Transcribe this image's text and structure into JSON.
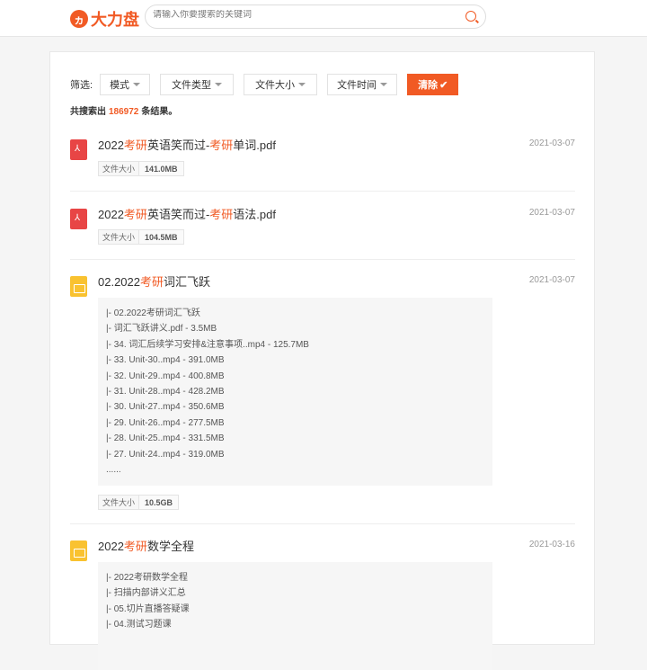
{
  "header": {
    "logo_text": "大力盘",
    "search_placeholder": "请输入你要搜索的关键词"
  },
  "filters": {
    "label": "筛选:",
    "buttons": [
      "模式",
      "文件类型",
      "文件大小",
      "文件时间"
    ],
    "clear_label": "清除"
  },
  "result_count": {
    "prefix": "共搜索出",
    "number": "186972",
    "suffix": "条结果。"
  },
  "size_label": "文件大小",
  "results": [
    {
      "type": "pdf",
      "title_parts": [
        "2022",
        "考研",
        "英语笑而过-",
        "考研",
        "单词.pdf"
      ],
      "date": "2021-03-07",
      "size": "141.0MB"
    },
    {
      "type": "pdf",
      "title_parts": [
        "2022",
        "考研",
        "英语笑而过-",
        "考研",
        "语法.pdf"
      ],
      "date": "2021-03-07",
      "size": "104.5MB"
    },
    {
      "type": "folder",
      "title_parts": [
        "02.2022",
        "考研",
        "词汇飞跃"
      ],
      "date": "2021-03-07",
      "size": "10.5GB",
      "files": [
        "|- 02.2022考研词汇飞跃",
        "|- 词汇飞跃讲义.pdf - 3.5MB",
        "|- 34. 词汇后续学习安排&注意事项..mp4 - 125.7MB",
        "|- 33. Unit-30..mp4 - 391.0MB",
        "|- 32. Unit-29..mp4 - 400.8MB",
        "|- 31. Unit-28..mp4 - 428.2MB",
        "|- 30. Unit-27..mp4 - 350.6MB",
        "|- 29. Unit-26..mp4 - 277.5MB",
        "|- 28. Unit-25..mp4 - 331.5MB",
        "|- 27. Unit-24..mp4 - 319.0MB",
        "......"
      ]
    },
    {
      "type": "folder",
      "title_parts": [
        "2022",
        "考研",
        "数学全程"
      ],
      "date": "2021-03-16",
      "files": [
        "|- 2022考研数学全程",
        "|- 扫描内部讲义汇总",
        "|- 05.切片直播答疑课",
        "|- 04.测试习题课"
      ]
    }
  ]
}
